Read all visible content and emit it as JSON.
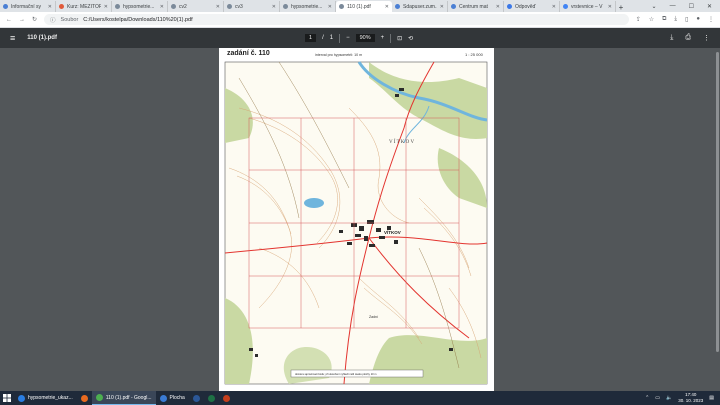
{
  "tabs": [
    {
      "title": "Informační sy",
      "color": "#4a7fd4"
    },
    {
      "title": "Kurz: MEZITOPO",
      "color": "#e05a3a"
    },
    {
      "title": "hypsometrie...",
      "color": "#7b8a9a"
    },
    {
      "title": "cv2",
      "color": "#7b8a9a"
    },
    {
      "title": "cv3",
      "color": "#7b8a9a"
    },
    {
      "title": "hypsometrie...",
      "color": "#7b8a9a"
    },
    {
      "title": "110 (1).pdf",
      "color": "#7b8a9a",
      "active": true
    },
    {
      "title": "Sdapuser.zum...",
      "color": "#4a7fd4"
    },
    {
      "title": "Centrum mat",
      "color": "#4a7fd4"
    },
    {
      "title": "Odpověď",
      "color": "#3b78e7"
    },
    {
      "title": "vrstevnice – V",
      "color": "#4285f4"
    }
  ],
  "window": {
    "minimize": "—",
    "maximize": "☐",
    "close": "✕",
    "tab_menu": "⌄",
    "new_tab": "+"
  },
  "toolbar": {
    "back": "←",
    "forward": "→",
    "reload": "↻",
    "source_label": "Soubor",
    "url": "C:/Users/kostelpa/Downloads/110%20(1).pdf"
  },
  "pdf": {
    "filename": "110 (1).pdf",
    "page_current": "1",
    "page_sep": "/",
    "page_total": "1",
    "zoom": "90%",
    "zoom_minus": "−",
    "zoom_plus": "+"
  },
  "map": {
    "title": "zadání č. 110",
    "interval_note": "interval pro hypsometrii: 10 m",
    "scale": "1 : 25 000",
    "town_label": "VÍTKOV",
    "region_label": "V Í T K O V",
    "peak_label": "Zadní",
    "bottom_note": "doménu aproximaci bodu; při ukončení vyhledí měli úseku plochy 10 m",
    "colors": {
      "paper": "#fdfbf2",
      "forest": "#c9d9a3",
      "water": "#6fb5dd",
      "contour": "#d6a474",
      "road": "#e3342f",
      "grid": "#d65b5b",
      "town": "#2b2b2b"
    }
  },
  "taskbar": {
    "items": [
      {
        "label": "hypsometrie_ukaz...",
        "color": "#2a7de1"
      },
      {
        "label": "",
        "color": "#e86a1f"
      },
      {
        "label": "110 (1).pdf - Googl...",
        "color": "#4caf50",
        "active": true
      },
      {
        "label": "Plocha",
        "color": "#3a7bd5"
      },
      {
        "label": "",
        "color": "#2b5797"
      },
      {
        "label": "",
        "color": "#1e7145"
      },
      {
        "label": "",
        "color": "#c43e1c"
      }
    ],
    "time": "17:40",
    "date": "30. 10. 2023"
  }
}
